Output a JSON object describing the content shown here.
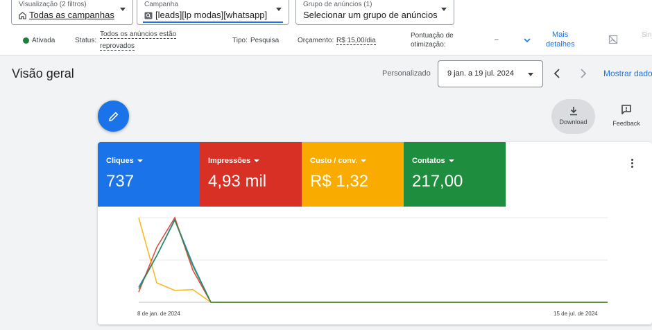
{
  "filters": {
    "view": {
      "label": "Visualização (2 filtros)",
      "value": "Todas as campanhas"
    },
    "campaign": {
      "label": "Campanha",
      "value": "[leads][lp modas][whatsapp]"
    },
    "adgroup": {
      "label": "Grupo de anúncios (1)",
      "value": "Selecionar um grupo de anúncios"
    }
  },
  "status_row": {
    "state": "Ativada",
    "status_label": "Status:",
    "status_line1": "Todos os anúncios estão",
    "status_line2": "reprovados",
    "type_label": "Tipo:",
    "type_value": "Pesquisa",
    "budget_label": "Orçamento:",
    "budget_value": "R$ 15,00/dia",
    "score_line1": "Pontuação de",
    "score_line2": "otimização:",
    "score_value": "–",
    "more_line1": "Mais",
    "more_line2": "detalhes",
    "cut_text": "Sin"
  },
  "header": {
    "title": "Visão geral",
    "custom_label": "Personalizado",
    "date_range": "9 jan. a 19 jul. 2024",
    "show_data": "Mostrar dado"
  },
  "actions": {
    "download": "Download",
    "feedback": "Feedback"
  },
  "metrics": [
    {
      "label": "Cliques",
      "value": "737",
      "color": "#1a73e8"
    },
    {
      "label": "Impressões",
      "value": "4,93 mil",
      "color": "#d93025"
    },
    {
      "label": "Custo / conv.",
      "value": "R$ 1,32",
      "color": "#f9ab00"
    },
    {
      "label": "Contatos",
      "value": "217,00",
      "color": "#1e8e3e"
    }
  ],
  "chart_data": {
    "type": "line",
    "x_start_label": "8 de jan. de 2024",
    "x_end_label": "15 de jul. de 2024",
    "ylim": [
      0,
      100
    ],
    "grid": true,
    "series": [
      {
        "name": "Cliques",
        "color": "#1a73e8",
        "values": [
          18,
          55,
          98,
          45,
          0,
          0,
          0,
          0,
          0,
          0,
          0,
          0,
          0,
          0,
          0,
          0,
          0,
          0,
          0,
          0,
          0,
          0,
          0,
          0,
          0,
          0,
          0
        ]
      },
      {
        "name": "Impressões",
        "color": "#d93025",
        "values": [
          12,
          65,
          100,
          38,
          0,
          0,
          0,
          0,
          0,
          0,
          0,
          0,
          0,
          0,
          0,
          0,
          0,
          0,
          0,
          0,
          0,
          0,
          0,
          0,
          0,
          0,
          0
        ]
      },
      {
        "name": "Custo / conv.",
        "color": "#f9ab00",
        "values": [
          100,
          23,
          14,
          15,
          0,
          0,
          0,
          0,
          0,
          0,
          0,
          0,
          0,
          0,
          0,
          0,
          0,
          0,
          0,
          0,
          0,
          0,
          0,
          0,
          0,
          0,
          0
        ]
      },
      {
        "name": "Contatos",
        "color": "#1e8e3e",
        "values": [
          16,
          55,
          97,
          43,
          0,
          0,
          0,
          0,
          0,
          0,
          0,
          0,
          0,
          0,
          0,
          0,
          0,
          0,
          0,
          0,
          0,
          0,
          0,
          0,
          0,
          0,
          0
        ]
      }
    ]
  }
}
